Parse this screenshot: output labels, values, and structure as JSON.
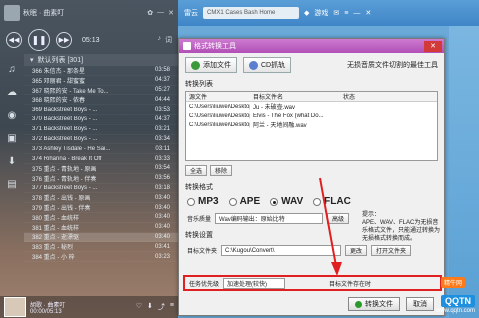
{
  "player": {
    "user": "秋眠 · 曲素叮",
    "time_top": "05:13",
    "time_total": "03:34",
    "playlist_title": "默认列表 [301]",
    "songs": [
      {
        "title": "366 朱信杰 - 那条星",
        "dur": "03:58"
      },
      {
        "title": "365 邓丽君 - 甜蜜蜜",
        "dur": "04:37"
      },
      {
        "title": "367 晓熙的安 - Take Me To...",
        "dur": "05:27"
      },
      {
        "title": "368 晓熙的安 - 侬春",
        "dur": "04:44"
      },
      {
        "title": "369 Backstreet Boys - ...",
        "dur": "03:53"
      },
      {
        "title": "370 Backstreet Boys - ...",
        "dur": "04:37"
      },
      {
        "title": "371 Backstreet Boys - ...",
        "dur": "03:21"
      },
      {
        "title": "372 Backstreet Boys - ...",
        "dur": "03:34"
      },
      {
        "title": "373 Ashley Tisdale - He Sai...",
        "dur": "03:11"
      },
      {
        "title": "374 Rihanna - Break It Off",
        "dur": "03:33"
      },
      {
        "title": "375 重点 - 青轨地 - 原画",
        "dur": "03:54"
      },
      {
        "title": "376 重点 - 青轨地 - 伴奏",
        "dur": "03:56"
      },
      {
        "title": "377 Backstreet Boys - ...",
        "dur": "03:18"
      },
      {
        "title": "378 重点 - 出钱 - 原画",
        "dur": "03:40"
      },
      {
        "title": "379 重点 - 出钱 - 伴奏",
        "dur": "03:40"
      },
      {
        "title": "380 重点 - 血统样",
        "dur": "03:40"
      },
      {
        "title": "381 重点 - 血统样",
        "dur": "03:40"
      },
      {
        "title": "382 重点 - 逝漂驱",
        "dur": "03:40"
      },
      {
        "title": "383 重点 - 秘烈",
        "dur": "03:41"
      },
      {
        "title": "384 重点 - 小 梓",
        "dur": "03:23"
      }
    ],
    "now_title": "胡歌 · 曲素叮",
    "now_time": "00:00/05:13"
  },
  "bgapp": {
    "search_placeholder": "CMX1 Cases Bash Home",
    "top_left": "雷云",
    "game": "游戏",
    "games_label": "游戏"
  },
  "dialog": {
    "title": "格式转换工具",
    "add_file": "添加文件",
    "cd_grab": "CD抓轨",
    "tip": "无损音质文件切割的最佳工具",
    "list_label": "转换列表",
    "col_source": "源文件",
    "col_target": "目标文件名",
    "col_status": "状态",
    "rows": [
      {
        "src": "C:\\Users\\liuwei\\Desktop\\...",
        "dst": "Ju - 未破壶.wav",
        "status": ""
      },
      {
        "src": "C:\\Users\\liuwei\\Desktop\\...",
        "dst": "Elvis - The Fox (what Do...",
        "status": ""
      },
      {
        "src": "C:\\Users\\liuwei\\Desktop\\...",
        "dst": "阿兰 - 天地间融.wav",
        "status": ""
      }
    ],
    "select_all": "全选",
    "remove": "移除",
    "format_label": "转换格式",
    "formats": [
      "MP3",
      "APE",
      "WAV",
      "FLAC"
    ],
    "selected_format": "WAV",
    "format_tip_title": "提示：",
    "format_tip_body": "APE、WAV、FLAC为无损音乐格式文件，只能通过转换为无损格式转换而成。",
    "quality_label": "音乐质量",
    "quality_value": "Wav编码输出：原始比特",
    "advanced": "高级",
    "settings_label": "转换设置",
    "target_folder_label": "目标文件夹",
    "target_folder_value": "C:\\Kugou\\Convert\\",
    "change": "更改",
    "open_folder": "打开文件夹",
    "priority_label": "任务优先级",
    "priority_value": "加速处理(较快)",
    "exists_label": "目标文件存在时",
    "convert_btn": "转换文件",
    "close_btn": "取消"
  },
  "watermark": {
    "top": "精牛网",
    "main": "QQTN",
    "sub": "www.qqtn.com"
  },
  "colors": {
    "title_purple": "#b14fb6",
    "highlight_red": "#e02020",
    "bg_blue": "#6aa9d8"
  }
}
